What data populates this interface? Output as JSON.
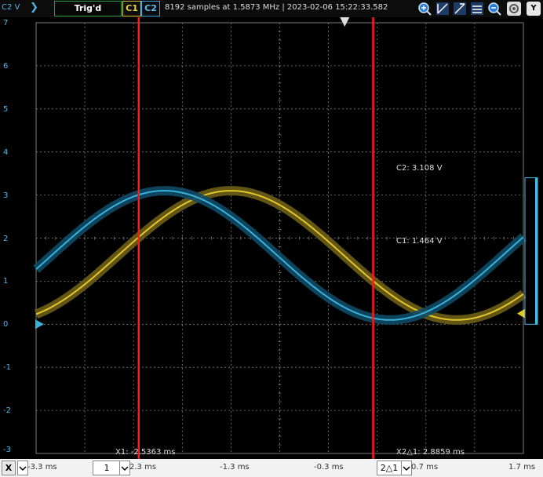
{
  "topbar": {
    "channel_scale": "C2 V",
    "trigger_status": "Trig'd",
    "c1_label": "C1",
    "c2_label": "C2",
    "acquisition_info": "8192 samples at 1.5873 MHz | 2023-02-06  15:22:33.582",
    "tools": [
      "zoom-in-icon",
      "cursor-x-icon",
      "cursor-x-multi-icon",
      "cursor-y-icon",
      "cursor-y-multi-icon",
      "zoom-out-icon",
      "settings-icon",
      "y-axis-button-icon"
    ],
    "y_button": "Y"
  },
  "y_axis": {
    "labels": [
      "7",
      "6",
      "5",
      "4",
      "3",
      "2",
      "1",
      "0",
      "-1",
      "-2",
      "-3"
    ]
  },
  "x_axis": {
    "x_button": "X",
    "labels": [
      "-3.3 ms",
      "2.3 ms",
      "-1.3 ms",
      "-0.3 ms",
      "0.7 ms",
      "1.7 ms"
    ],
    "x_selector": "1",
    "delta_selector": "2△1"
  },
  "cursors": {
    "x1_label": "X1: -2.5363 ms",
    "x2_label": "X2△1: 2.8859 ms",
    "c2_readout": "C2: 3.108 V",
    "c1_readout": "C1: 1.464 V"
  },
  "colors": {
    "c1": "#e2c62d",
    "c2": "#38b2dc",
    "cursor": "#ff1a1a",
    "grid": "#7a7a7a",
    "trigger_box": "#2e9e3a"
  },
  "chart_data": {
    "type": "line",
    "x_range_ms": [
      -3.8,
      2.2
    ],
    "ylim": [
      -3,
      7
    ],
    "grid": true,
    "series": [
      {
        "name": "C1",
        "frequency_hz": 180,
        "offset_v": 1.6,
        "amplitude_v": 1.5,
        "peak_time_ms": -1.4
      },
      {
        "name": "C2",
        "frequency_hz": 180,
        "offset_v": 1.6,
        "amplitude_v": 1.5,
        "peak_time_ms": -2.22
      }
    ],
    "cursors_ms": {
      "x1": -2.5363,
      "x2": 0.3496
    }
  }
}
